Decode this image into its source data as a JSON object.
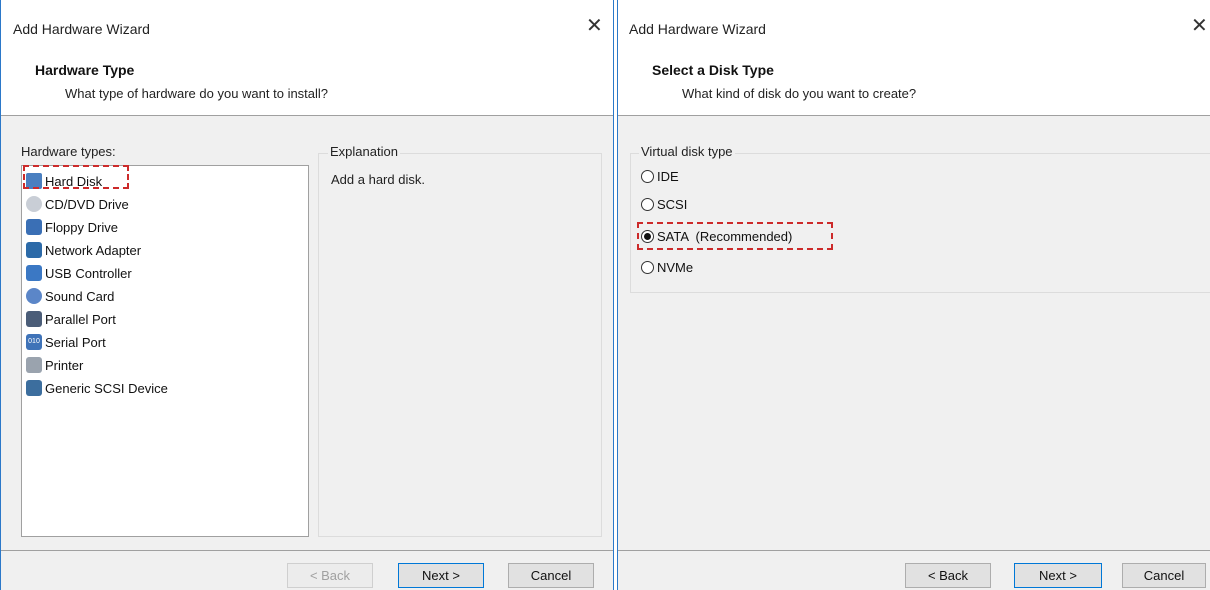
{
  "left": {
    "window_title": "Add Hardware Wizard",
    "close_glyph": "✕",
    "heading": "Hardware Type",
    "subheading": "What type of hardware do you want to install?",
    "list_label": "Hardware types:",
    "explanation_label": "Explanation",
    "explanation_text": "Add a hard disk.",
    "items": [
      {
        "label": "Hard Disk",
        "icon": "hard-disk-icon",
        "selected": true
      },
      {
        "label": "CD/DVD Drive",
        "icon": "cd-dvd-icon"
      },
      {
        "label": "Floppy Drive",
        "icon": "floppy-icon"
      },
      {
        "label": "Network Adapter",
        "icon": "network-adapter-icon"
      },
      {
        "label": "USB Controller",
        "icon": "usb-icon"
      },
      {
        "label": "Sound Card",
        "icon": "sound-card-icon"
      },
      {
        "label": "Parallel Port",
        "icon": "parallel-port-icon"
      },
      {
        "label": "Serial Port",
        "icon": "serial-port-icon"
      },
      {
        "label": "Printer",
        "icon": "printer-icon"
      },
      {
        "label": "Generic SCSI Device",
        "icon": "scsi-device-icon"
      }
    ],
    "buttons": {
      "back": "< Back",
      "next": "Next >",
      "cancel": "Cancel"
    }
  },
  "right": {
    "window_title": "Add Hardware Wizard",
    "close_glyph": "✕",
    "heading": "Select a Disk Type",
    "subheading": "What kind of disk do you want to create?",
    "group_label": "Virtual disk type",
    "options": [
      {
        "label": "IDE",
        "checked": false
      },
      {
        "label": "SCSI",
        "checked": false
      },
      {
        "label": "SATA  (Recommended)",
        "checked": true
      },
      {
        "label": "NVMe",
        "checked": false
      }
    ],
    "buttons": {
      "back": "< Back",
      "next": "Next >",
      "cancel": "Cancel"
    }
  },
  "colors": {
    "accent": "#0078d7",
    "highlight": "#cc2a2a"
  }
}
